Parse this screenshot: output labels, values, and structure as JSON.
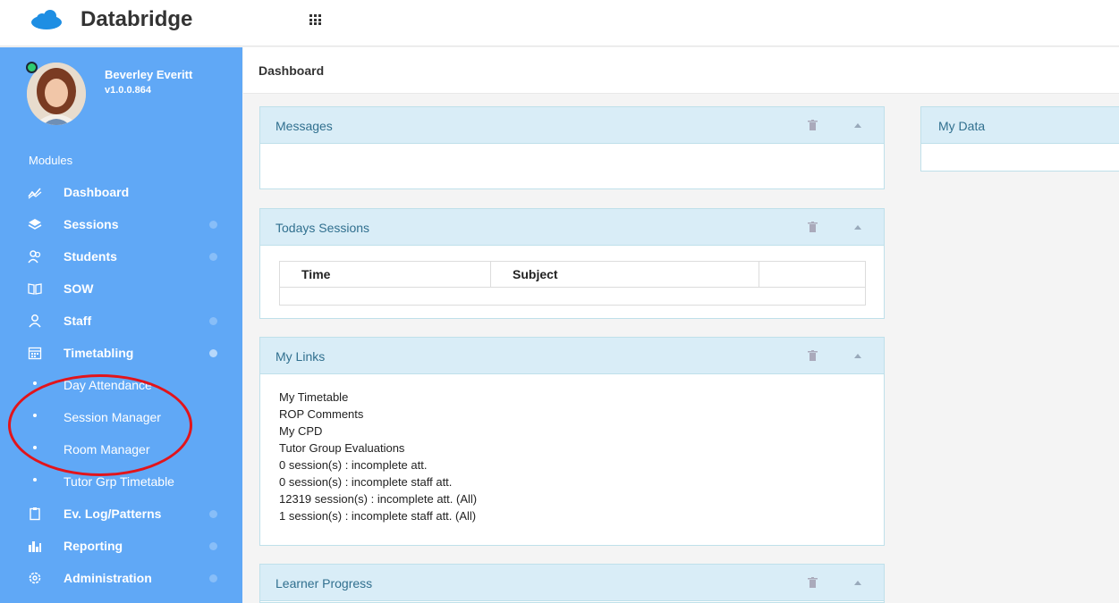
{
  "app": {
    "brand": "Databridge"
  },
  "user": {
    "name": "Beverley Everitt",
    "version": "v1.0.0.864"
  },
  "sidebar": {
    "section_title": "Modules",
    "items": [
      {
        "label": "Dashboard",
        "icon": "chart-line-icon"
      },
      {
        "label": "Sessions",
        "icon": "layers-icon"
      },
      {
        "label": "Students",
        "icon": "users-icon"
      },
      {
        "label": "SOW",
        "icon": "book-icon"
      },
      {
        "label": "Staff",
        "icon": "user-icon"
      },
      {
        "label": "Timetabling",
        "icon": "calendar-icon"
      },
      {
        "label": "Ev. Log/Patterns",
        "icon": "clipboard-icon"
      },
      {
        "label": "Reporting",
        "icon": "bar-chart-icon"
      },
      {
        "label": "Administration",
        "icon": "gear-icon"
      }
    ],
    "timetabling_sub": [
      {
        "label": "Day Attendance"
      },
      {
        "label": "Session Manager"
      },
      {
        "label": "Room Manager"
      },
      {
        "label": "Tutor Grp Timetable"
      }
    ]
  },
  "page": {
    "title": "Dashboard"
  },
  "panels": {
    "messages": {
      "title": "Messages"
    },
    "todays_sessions": {
      "title": "Todays Sessions",
      "columns": [
        "Time",
        "Subject",
        ""
      ]
    },
    "my_links": {
      "title": "My Links",
      "links": [
        "My Timetable",
        "ROP Comments",
        "My CPD",
        "Tutor Group Evaluations",
        "0 session(s) : incomplete att.",
        "0 session(s) : incomplete staff att.",
        "12319 session(s) : incomplete att. (All)",
        "1 session(s) : incomplete staff att. (All)"
      ]
    },
    "learner_progress": {
      "title": "Learner Progress"
    },
    "my_data": {
      "title": "My Data"
    }
  },
  "colors": {
    "sidebar": "#60a8f6",
    "panel_header": "#d9edf7",
    "panel_title": "#31708f",
    "highlight": "#e2141b"
  }
}
